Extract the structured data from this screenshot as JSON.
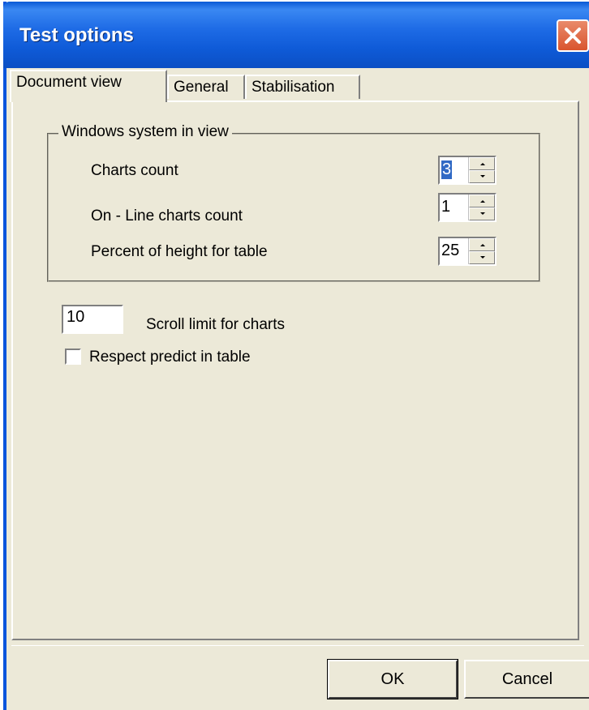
{
  "window": {
    "title": "Test options"
  },
  "tabs": [
    {
      "label": "Document view",
      "active": true
    },
    {
      "label": "General",
      "active": false
    },
    {
      "label": "Stabilisation",
      "active": false
    }
  ],
  "group": {
    "legend": "Windows system in view",
    "fields": [
      {
        "label": "Charts count",
        "value": "3",
        "selected": true
      },
      {
        "label": "On - Line charts count",
        "value": "1",
        "selected": false
      },
      {
        "label": "Percent of height for table",
        "value": "25",
        "selected": false
      }
    ]
  },
  "scroll": {
    "value": "10",
    "label": "Scroll limit for charts"
  },
  "respect": {
    "label": "Respect predict in table",
    "checked": false
  },
  "buttons": {
    "ok": "OK",
    "cancel": "Cancel"
  },
  "colors": {
    "title_bar": "#0a5ad6",
    "window_bg": "#ece9d8",
    "selection": "#316ac5",
    "close_button": "#d9552e"
  },
  "icons": {
    "close": "close-icon"
  }
}
